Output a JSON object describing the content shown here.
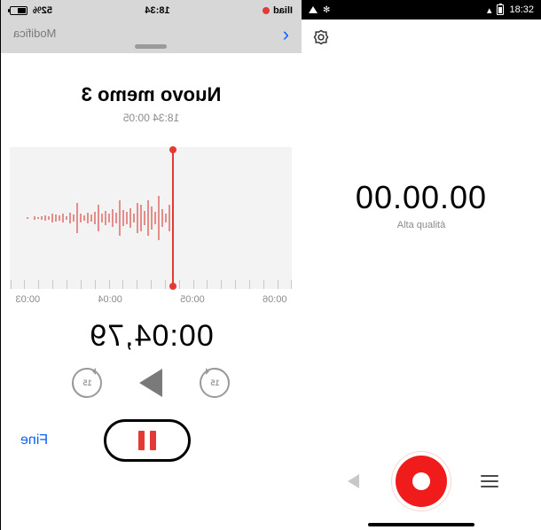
{
  "left_phone": {
    "statusbar": {
      "carrier": "Iliad",
      "time": "18:34",
      "battery": "52%"
    },
    "header": {
      "modifica": "Modifica"
    },
    "memo": {
      "title": "Nuovo memo 3",
      "subtitle": "18:34  00:05"
    },
    "tick_labels": [
      "00:06",
      "00:05",
      "00:04",
      "00:03"
    ],
    "big_time": "00:04,79",
    "skip_seconds": "15",
    "controls": {
      "fine": "Fine"
    }
  },
  "right_phone": {
    "statusbar": {
      "time": "18:32"
    },
    "big_zero": "00.00.00",
    "quality": "Alta qualità"
  }
}
